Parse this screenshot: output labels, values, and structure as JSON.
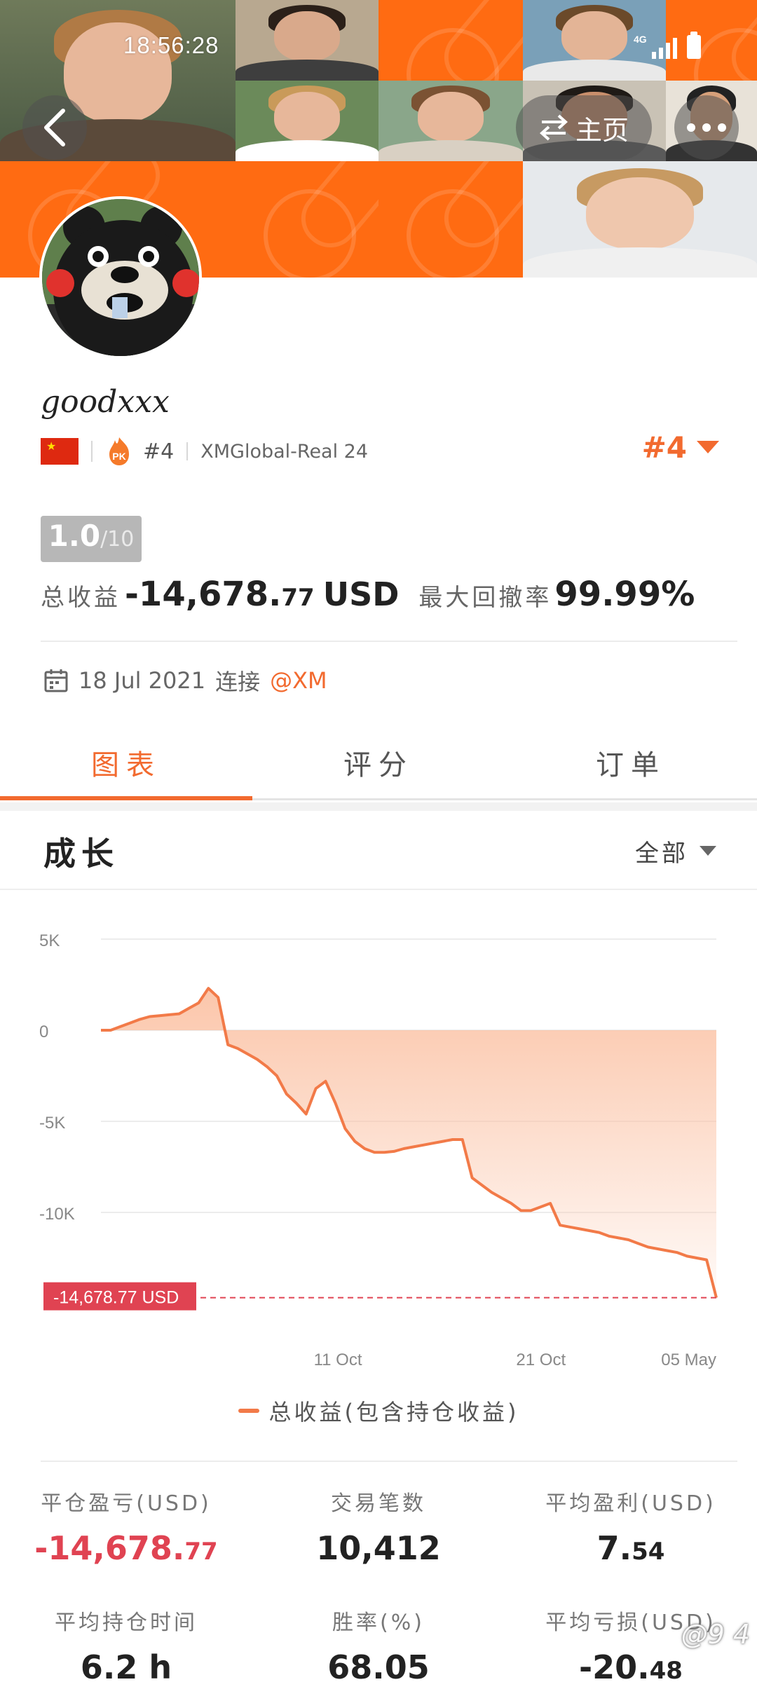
{
  "status_bar": {
    "time": "18:56:28",
    "network": "4G"
  },
  "nav": {
    "home_label": "主页"
  },
  "profile": {
    "username": "goodxxx",
    "rank_small": "#4",
    "account": "XMGlobal-Real 24",
    "rank_big": "#4",
    "score": "1.0",
    "score_denominator": "/10",
    "total_profit_label": "总收益",
    "total_profit_main": "-14,678.",
    "total_profit_decimals": "77",
    "total_profit_unit": "USD",
    "max_drawdown_label": "最大回撤率",
    "max_drawdown_value": "99.99%",
    "connected_date": "18 Jul 2021",
    "connected_label": "连接",
    "broker": "@XM"
  },
  "tabs": [
    {
      "label": "图表",
      "active": true
    },
    {
      "label": "评分",
      "active": false
    },
    {
      "label": "订单",
      "active": false
    }
  ],
  "growth": {
    "title": "成长",
    "period": "全部"
  },
  "chart_data": {
    "type": "area",
    "title": "",
    "y_ticks": [
      "5K",
      "0",
      "-5K",
      "-10K"
    ],
    "ylim": [
      -15000,
      5000
    ],
    "x_ticks": [
      "11 Oct",
      "21 Oct",
      "05 May"
    ],
    "current_label": "-14,678.77 USD",
    "legend": "总收益(包含持仓收益)",
    "colors": {
      "line": "#f27a48",
      "fill_top": "#fbc3a6",
      "marker": "#e04352"
    },
    "series": [
      {
        "name": "总收益(包含持仓收益)",
        "values": [
          0,
          0,
          200,
          400,
          600,
          750,
          800,
          850,
          900,
          1200,
          1500,
          2300,
          1800,
          -800,
          -1000,
          -1300,
          -1600,
          -2000,
          -2500,
          -3500,
          -4000,
          -4600,
          -3200,
          -2800,
          -4000,
          -5400,
          -6100,
          -6500,
          -6700,
          -6700,
          -6650,
          -6500,
          -6400,
          -6300,
          -6200,
          -6100,
          -6000,
          -6000,
          -8100,
          -8500,
          -8900,
          -9200,
          -9500,
          -9900,
          -9900,
          -9700,
          -9500,
          -10700,
          -10800,
          -10900,
          -11000,
          -11100,
          -11300,
          -11400,
          -11500,
          -11700,
          -11900,
          -12000,
          -12100,
          -12200,
          -12400,
          -12500,
          -12600,
          -14678.77
        ]
      }
    ]
  },
  "stats": [
    {
      "label": "平仓盈亏(USD)",
      "value_main": "-14,678.",
      "value_decimals": "77",
      "negative": true
    },
    {
      "label": "交易笔数",
      "value_main": "10,412",
      "value_decimals": "",
      "negative": false
    },
    {
      "label": "平均盈利(USD)",
      "value_main": "7.",
      "value_decimals": "54",
      "negative": false
    },
    {
      "label": "平均持仓时间",
      "value_main": "6.2 h",
      "value_decimals": "",
      "negative": false
    },
    {
      "label": "胜率(%)",
      "value_main": "68.05",
      "value_decimals": "",
      "negative": false
    },
    {
      "label": "平均亏损(USD)",
      "value_main": "-20.",
      "value_decimals": "48",
      "negative": false
    }
  ],
  "watermark": "@9 4"
}
